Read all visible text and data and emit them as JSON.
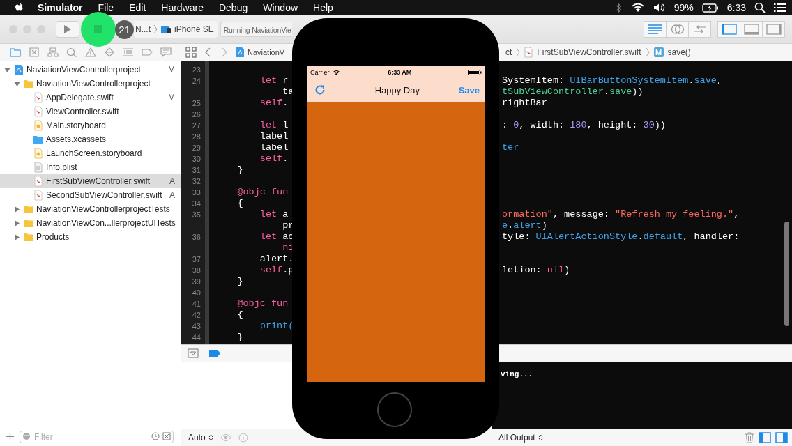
{
  "menu_bar": {
    "app": "Simulator",
    "items": [
      "File",
      "Edit",
      "Hardware",
      "Debug",
      "Window",
      "Help"
    ],
    "battery": "99%",
    "clock": "6:33"
  },
  "toolbar": {
    "badge": "21",
    "scheme": "N...t",
    "device": "iPhone SE",
    "activity": "Running NaviationVie",
    "editor_modes": [
      {
        "kind": "lines",
        "selected": true
      },
      {
        "kind": "rings",
        "selected": false
      },
      {
        "kind": "arrows",
        "selected": false
      }
    ],
    "panels": [
      {
        "kind": "left",
        "on": true
      },
      {
        "kind": "bottom",
        "on": false
      },
      {
        "kind": "right",
        "on": false
      }
    ]
  },
  "navigator": {
    "tabs": [
      {
        "kind": "folder",
        "selected": true
      },
      {
        "kind": "symbol",
        "selected": false
      },
      {
        "kind": "hierarchy",
        "selected": false
      },
      {
        "kind": "search",
        "selected": false
      },
      {
        "kind": "warning",
        "selected": false
      },
      {
        "kind": "diamond",
        "selected": false
      },
      {
        "kind": "bars",
        "selected": false
      },
      {
        "kind": "tag",
        "selected": false
      },
      {
        "kind": "bubble",
        "selected": false
      }
    ],
    "tree": [
      {
        "kind": "project",
        "name": "NaviationViewControllerproject",
        "status": "M",
        "expanded": true,
        "selected": false,
        "children": [
          {
            "kind": "folder",
            "name": "NaviationViewControllerproject",
            "expanded": true,
            "selected": false,
            "children": [
              {
                "kind": "swift",
                "name": "AppDelegate.swift",
                "status": "M",
                "selected": false
              },
              {
                "kind": "swift",
                "name": "ViewController.swift",
                "selected": false
              },
              {
                "kind": "storyboard",
                "name": "Main.storyboard",
                "selected": false
              },
              {
                "kind": "assets",
                "name": "Assets.xcassets",
                "selected": false
              },
              {
                "kind": "storyboard",
                "name": "LaunchScreen.storyboard",
                "selected": false
              },
              {
                "kind": "plist",
                "name": "Info.plist",
                "selected": false
              },
              {
                "kind": "swift",
                "name": "FirstSubViewController.swift",
                "status": "A",
                "selected": true
              },
              {
                "kind": "swift",
                "name": "SecondSubViewController.swift",
                "status": "A",
                "selected": false
              }
            ]
          },
          {
            "kind": "folder",
            "name": "NaviationViewControllerprojectTests",
            "expanded": false,
            "selected": false
          },
          {
            "kind": "folder",
            "name": "NaviationViewCon...llerprojectUITests",
            "expanded": false,
            "selected": false
          },
          {
            "kind": "folder",
            "name": "Products",
            "expanded": false,
            "selected": false
          }
        ]
      }
    ],
    "filter": {
      "placeholder": "Filter"
    }
  },
  "jump_bar": [
    {
      "kind": "project",
      "label": "NaviationV"
    },
    {
      "kind": "plain",
      "label": "ct"
    },
    {
      "kind": "swift",
      "label": "FirstSubViewController.swift"
    },
    {
      "kind": "method",
      "label": "save()",
      "badge": "M"
    }
  ],
  "editor": {
    "lines": [
      {
        "number": "23"
      },
      {
        "number": "24",
        "left": [
          {
            "text": "        let",
            "kind": "kw"
          },
          {
            "text": " r",
            "kind": "plain"
          }
        ],
        "right": [
          {
            "text": "SystemItem: ",
            "kind": "plain"
          },
          {
            "text": "UIBarButtonSystemItem",
            "kind": "type"
          },
          {
            "text": ".",
            "kind": "plain"
          },
          {
            "text": "save",
            "kind": "type"
          },
          {
            "text": ",",
            "kind": "plain"
          }
        ]
      },
      {
        "left": [
          {
            "text": "            ta",
            "kind": "plain"
          }
        ],
        "right": [
          {
            "text": "tSubViewController",
            "kind": "fn"
          },
          {
            "text": ".",
            "kind": "plain"
          },
          {
            "text": "save",
            "kind": "fn"
          },
          {
            "text": "))",
            "kind": "plain"
          }
        ]
      },
      {
        "number": "25",
        "left": [
          {
            "text": "        self",
            "kind": "kw"
          },
          {
            "text": ".",
            "kind": "plain"
          }
        ],
        "right": [
          {
            "text": "rightBar",
            "kind": "plain"
          }
        ]
      },
      {
        "number": "26"
      },
      {
        "number": "27",
        "left": [
          {
            "text": "        let",
            "kind": "kw"
          },
          {
            "text": " l",
            "kind": "plain"
          }
        ],
        "right": [
          {
            "text": ": ",
            "kind": "plain"
          },
          {
            "text": "0",
            "kind": "num"
          },
          {
            "text": ", width: ",
            "kind": "plain"
          },
          {
            "text": "180",
            "kind": "num"
          },
          {
            "text": ", height: ",
            "kind": "plain"
          },
          {
            "text": "30",
            "kind": "num"
          },
          {
            "text": "))",
            "kind": "plain"
          }
        ]
      },
      {
        "number": "28",
        "left": [
          {
            "text": "        label",
            "kind": "plain"
          }
        ]
      },
      {
        "number": "29",
        "left": [
          {
            "text": "        label",
            "kind": "plain"
          }
        ],
        "right": [
          {
            "text": "ter",
            "kind": "type"
          }
        ]
      },
      {
        "number": "30",
        "left": [
          {
            "text": "        self",
            "kind": "kw"
          },
          {
            "text": ".",
            "kind": "plain"
          }
        ]
      },
      {
        "number": "31",
        "left": [
          {
            "text": "    }",
            "kind": "plain"
          }
        ]
      },
      {
        "number": "32"
      },
      {
        "number": "33",
        "left": [
          {
            "text": "    @objc fun",
            "kind": "kw"
          }
        ]
      },
      {
        "number": "34",
        "left": [
          {
            "text": "    {",
            "kind": "plain"
          }
        ]
      },
      {
        "number": "35",
        "left": [
          {
            "text": "        let",
            "kind": "kw"
          },
          {
            "text": " a",
            "kind": "plain"
          }
        ],
        "right": [
          {
            "text": "ormation\"",
            "kind": "str"
          },
          {
            "text": ", message: ",
            "kind": "plain"
          },
          {
            "text": "\"Refresh my feeling.\"",
            "kind": "str"
          },
          {
            "text": ",",
            "kind": "plain"
          }
        ]
      },
      {
        "left": [
          {
            "text": "            pr",
            "kind": "plain"
          }
        ],
        "right": [
          {
            "text": "e",
            "kind": "type"
          },
          {
            "text": ".",
            "kind": "plain"
          },
          {
            "text": "alert",
            "kind": "type"
          },
          {
            "text": ")",
            "kind": "plain"
          }
        ]
      },
      {
        "number": "36",
        "left": [
          {
            "text": "        let",
            "kind": "kw"
          },
          {
            "text": " ac",
            "kind": "plain"
          }
        ],
        "right": [
          {
            "text": "tyle: ",
            "kind": "plain"
          },
          {
            "text": "UIAlertActionStyle",
            "kind": "type"
          },
          {
            "text": ".",
            "kind": "plain"
          },
          {
            "text": "default",
            "kind": "type"
          },
          {
            "text": ", handler:",
            "kind": "plain"
          }
        ]
      },
      {
        "left": [
          {
            "text": "            ni",
            "kind": "kw"
          }
        ]
      },
      {
        "number": "37",
        "left": [
          {
            "text": "        alert.",
            "kind": "plain"
          }
        ]
      },
      {
        "number": "38",
        "left": [
          {
            "text": "        self",
            "kind": "kw"
          },
          {
            "text": ".p",
            "kind": "plain"
          }
        ],
        "right": [
          {
            "text": "letion: ",
            "kind": "plain"
          },
          {
            "text": "nil",
            "kind": "kw"
          },
          {
            "text": ")",
            "kind": "plain"
          }
        ]
      },
      {
        "number": "39",
        "left": [
          {
            "text": "    }",
            "kind": "plain"
          }
        ]
      },
      {
        "number": "40"
      },
      {
        "number": "41",
        "left": [
          {
            "text": "    @objc fun",
            "kind": "kw"
          }
        ]
      },
      {
        "number": "42",
        "left": [
          {
            "text": "    {",
            "kind": "plain"
          }
        ]
      },
      {
        "number": "43",
        "left": [
          {
            "text": "        print(",
            "kind": "type"
          }
        ]
      },
      {
        "number": "44",
        "left": [
          {
            "text": "    }",
            "kind": "plain"
          }
        ]
      }
    ]
  },
  "debug_area": {
    "scope": "Auto",
    "console_output": "ving...",
    "console_filter": "All Output"
  },
  "simulator": {
    "carrier": "Carrier",
    "time": "6:33 AM",
    "title": "Happy Day",
    "right_button": "Save"
  }
}
